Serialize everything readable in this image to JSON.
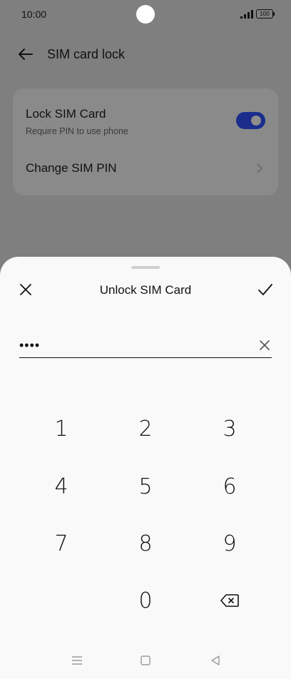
{
  "status_bar": {
    "time": "10:00",
    "battery": "100"
  },
  "app_bar": {
    "title": "SIM card lock"
  },
  "settings": {
    "lock_sim": {
      "title": "Lock SIM Card",
      "subtitle": "Require PIN to use phone",
      "enabled": true
    },
    "change_pin": {
      "title": "Change SIM PIN"
    }
  },
  "sheet": {
    "title": "Unlock SIM Card",
    "pin_value": "••••"
  },
  "keypad": {
    "keys": [
      "1",
      "2",
      "3",
      "4",
      "5",
      "6",
      "7",
      "8",
      "9",
      "0"
    ]
  },
  "colors": {
    "toggle_on": "#1a2d8c",
    "sheet_bg": "#f9f9f9",
    "scrim": "#7f7f7f"
  },
  "icons": [
    "back-arrow-icon",
    "chevron-right-icon",
    "close-icon",
    "check-icon",
    "clear-icon",
    "backspace-icon",
    "menu-icon",
    "home-icon",
    "back-triangle-icon"
  ]
}
